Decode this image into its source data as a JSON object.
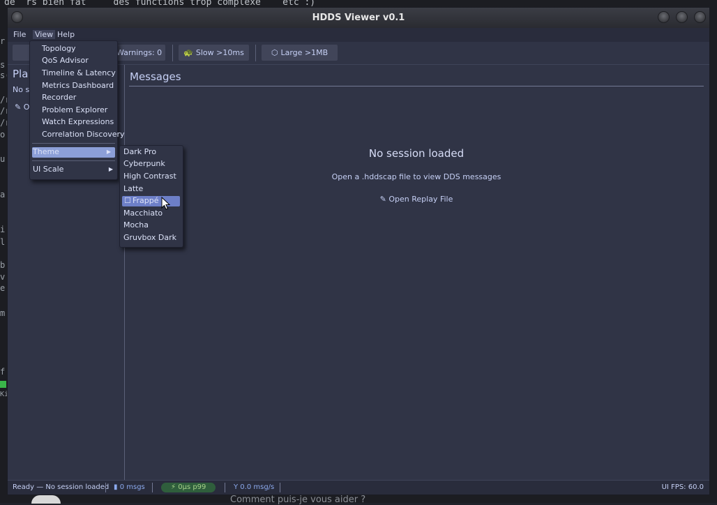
{
  "background": {
    "top_text": "de  rs bien fat     des functions trop complexe    etc :)",
    "left_chars": [
      "r",
      "s",
      "s(",
      "/r",
      "/r",
      "/r",
      "o",
      "u",
      "a",
      "i",
      "l",
      "b",
      "v",
      "e",
      "m",
      "f",
      "Kit"
    ],
    "bottom_text": "Comment puis-je vous aider ?"
  },
  "window": {
    "title": "HDDS Viewer v0.1"
  },
  "menubar": {
    "file": "File",
    "view": "View",
    "help": "Help"
  },
  "toolbar": {
    "warnings": "Warnings: 0",
    "slow": "Slow >10ms",
    "large": "Large >1MB"
  },
  "left_panel": {
    "title": "Pla",
    "subtitle": "No s",
    "open_label": "O"
  },
  "main": {
    "title": "Messages",
    "empty_title": "No session loaded",
    "empty_subtitle": "Open a .hddscap file to view DDS messages",
    "open_button": "Open Replay File"
  },
  "view_menu": {
    "items": [
      "Topology",
      "QoS Advisor",
      "Timeline & Latency",
      "Metrics Dashboard",
      "Recorder",
      "Problem Explorer",
      "Watch Expressions",
      "Correlation Discovery"
    ],
    "theme": "Theme",
    "ui_scale": "UI Scale"
  },
  "theme_menu": {
    "items": [
      "Dark Pro",
      "Cyberpunk",
      "High Contrast",
      "Latte",
      "Frappé",
      "Macchiato",
      "Mocha",
      "Gruvbox Dark"
    ],
    "selected": "Frappé"
  },
  "statusbar": {
    "ready": "Ready — No session loaded",
    "msgs": "0 msgs",
    "latency": "0µs p99",
    "rate": "0.0 msg/s",
    "fps": "UI FPS: 60.0"
  }
}
